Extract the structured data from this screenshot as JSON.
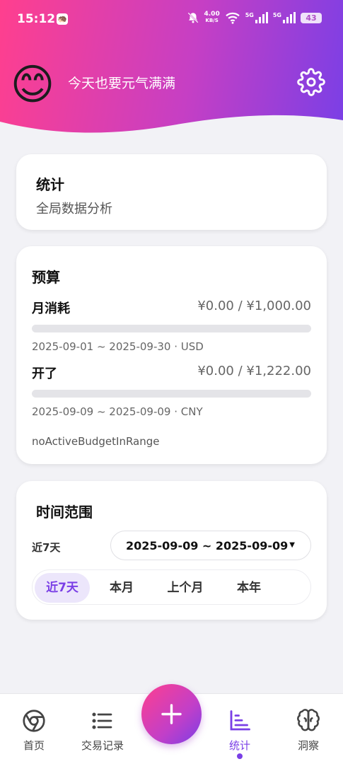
{
  "status_bar": {
    "time": "15:12",
    "net_speed_value": "4.00",
    "net_speed_unit": "KB/S",
    "signal1_label": "5G",
    "signal2_label": "5G",
    "battery": "43"
  },
  "header": {
    "avatar_emoji": "😊",
    "greeting": "今天也要元气满满",
    "settings_icon": "gear-icon",
    "gradient": [
      "#ff3f8e",
      "#c63fc4",
      "#7a3fe6"
    ]
  },
  "stats_card": {
    "title": "统计",
    "subtitle": "全局数据分析"
  },
  "budget_card": {
    "title": "预算",
    "items": [
      {
        "name": "月消耗",
        "amount": "¥0.00 / ¥1,000.00",
        "progress": 0,
        "meta": "2025-09-01 ~ 2025-09-30 · USD"
      },
      {
        "name": "开了",
        "amount": "¥0.00 / ¥1,222.00",
        "progress": 0,
        "meta": "2025-09-09 ~ 2025-09-09 · CNY"
      }
    ],
    "empty_note": "noActiveBudgetInRange"
  },
  "range_card": {
    "title": "时间范围",
    "current_label": "近7天",
    "selected_range": "2025-09-09 ~ 2025-09-09",
    "quick_tabs": [
      {
        "label": "近7天",
        "active": true
      },
      {
        "label": "本月",
        "active": false
      },
      {
        "label": "上个月",
        "active": false
      },
      {
        "label": "本年",
        "active": false
      }
    ]
  },
  "bottom_nav": {
    "items": [
      {
        "label": "首页",
        "icon": "chrome-icon",
        "active": false
      },
      {
        "label": "交易记录",
        "icon": "list-icon",
        "active": false
      },
      {
        "label": "统计",
        "icon": "bar-chart-icon",
        "active": true
      },
      {
        "label": "洞察",
        "icon": "brain-icon",
        "active": false
      }
    ],
    "fab_icon": "plus-icon"
  },
  "colors": {
    "accent": "#7a3fe6",
    "pink": "#ff3f8e",
    "background": "#f2f2f6"
  }
}
